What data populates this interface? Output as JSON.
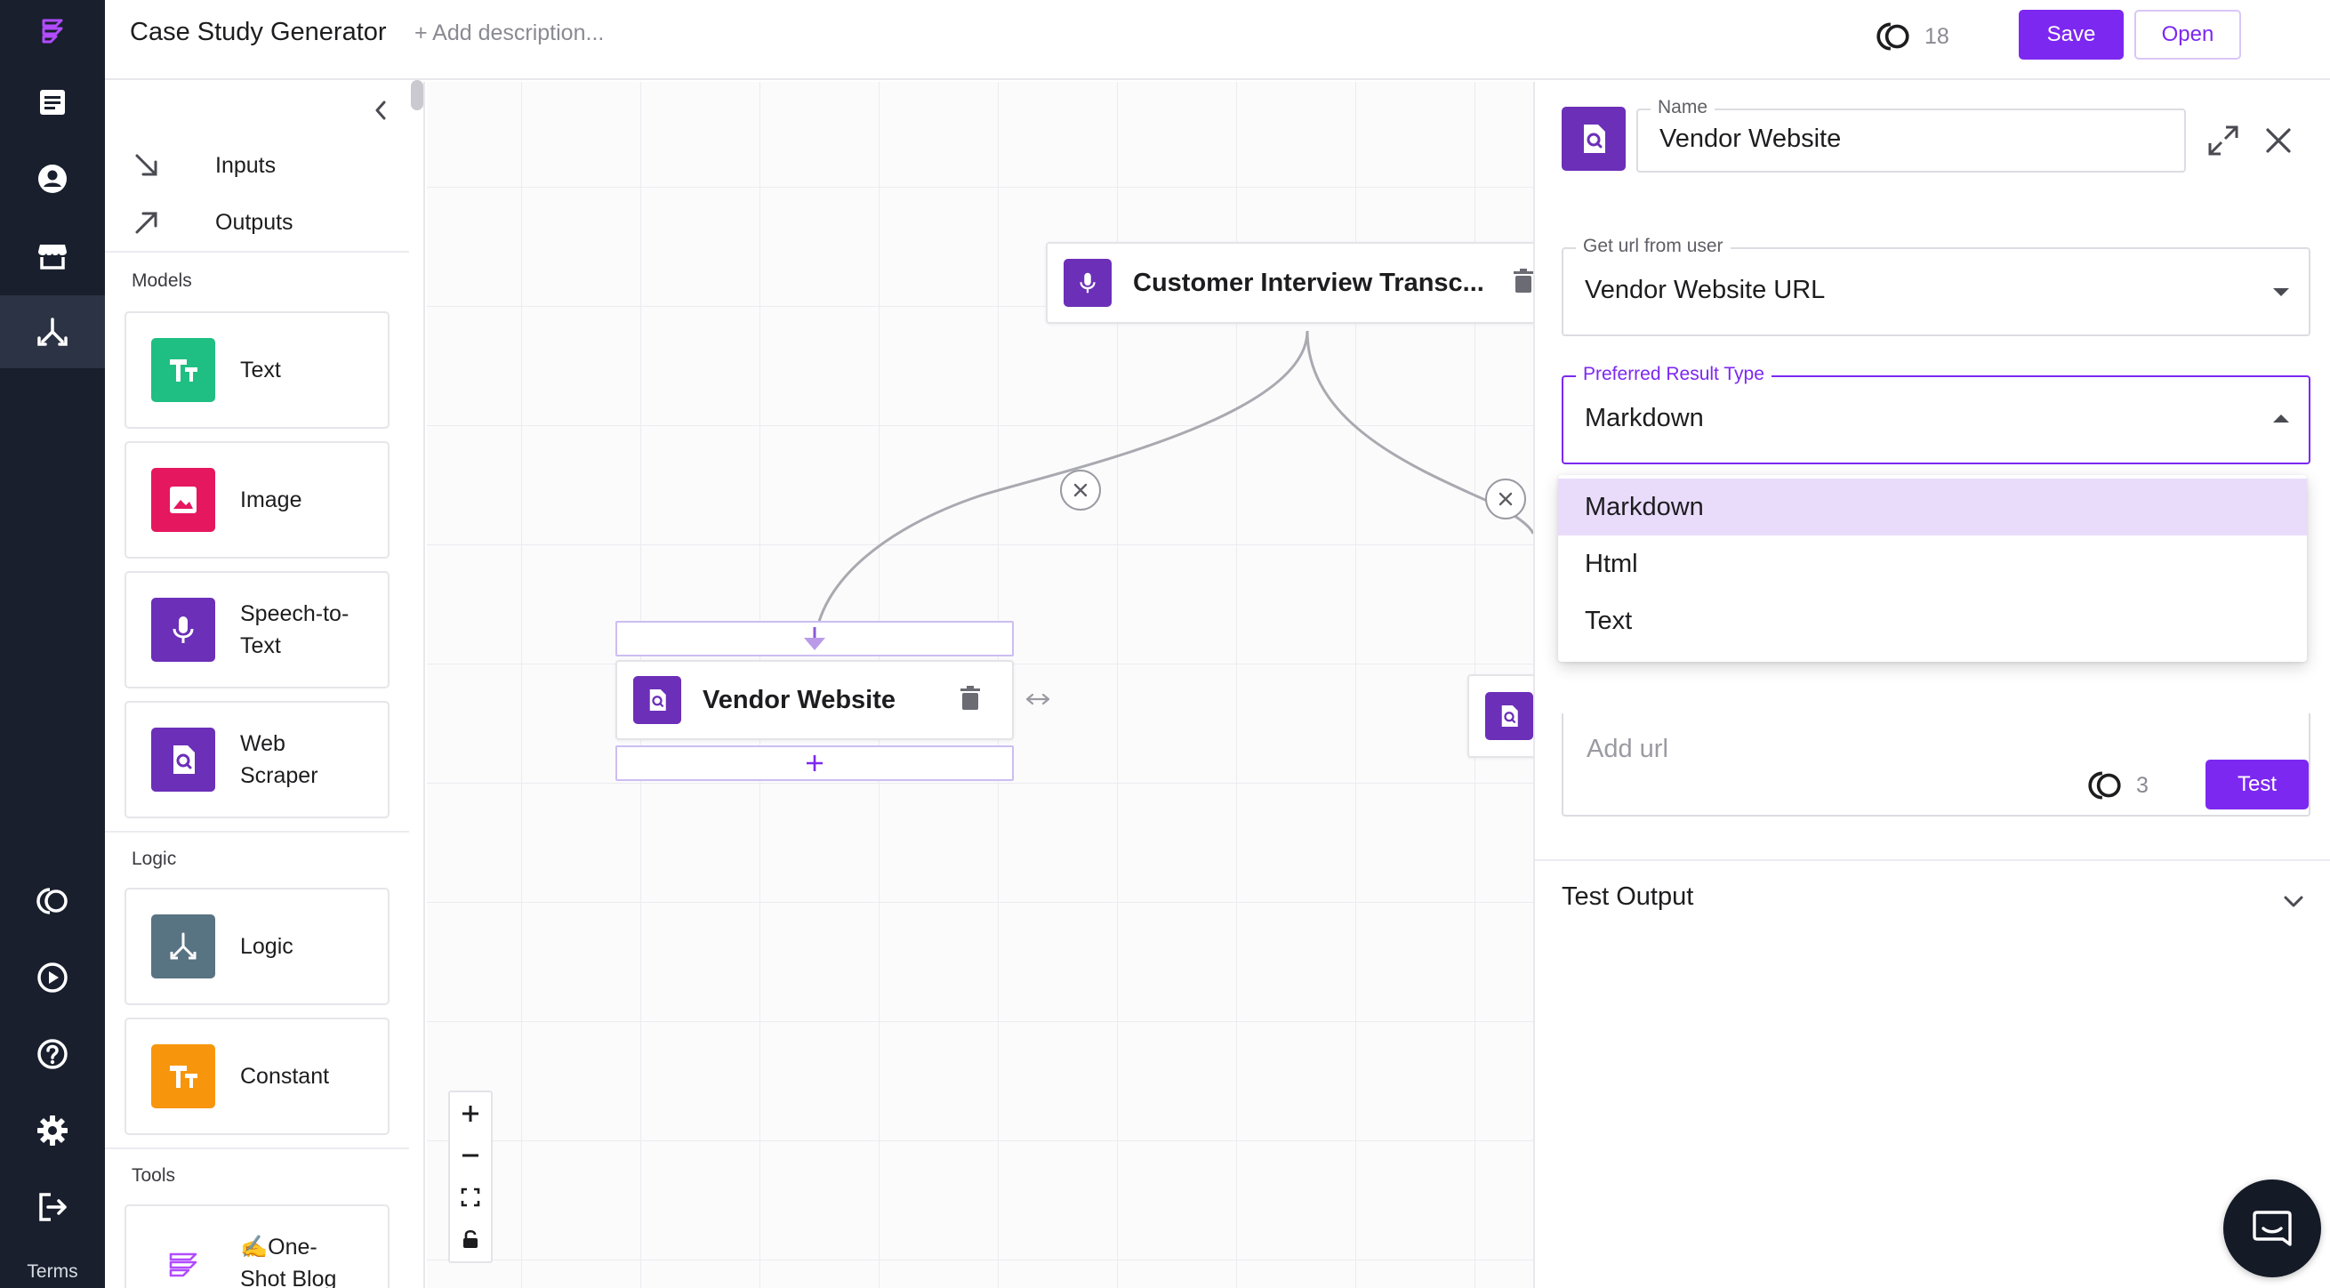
{
  "app": {
    "title": "Case Study Generator",
    "description_placeholder": "+ Add description...",
    "credits": "18",
    "save_label": "Save",
    "open_label": "Open",
    "accent_color": "#7c28f0"
  },
  "rail": {
    "items": [
      {
        "name": "logo-icon"
      },
      {
        "name": "documents-icon"
      },
      {
        "name": "account-icon"
      },
      {
        "name": "store-icon"
      },
      {
        "name": "workflow-icon",
        "active": true
      },
      {
        "name": "credits-icon"
      },
      {
        "name": "play-icon"
      },
      {
        "name": "help-icon"
      },
      {
        "name": "settings-icon"
      },
      {
        "name": "logout-icon"
      }
    ],
    "terms_label": "Terms"
  },
  "palette": {
    "inputs_label": "Inputs",
    "outputs_label": "Outputs",
    "sections": {
      "models": "Models",
      "logic": "Logic",
      "tools": "Tools"
    },
    "models": [
      {
        "label": "Text",
        "color": "#1fbf83",
        "icon": "text-icon"
      },
      {
        "label": "Image",
        "color": "#e5175f",
        "icon": "image-icon"
      },
      {
        "label": "Speech-to-\nText",
        "color": "#6b2fb8",
        "icon": "microphone-icon"
      },
      {
        "label": "Web\nScraper",
        "color": "#6b2fb8",
        "icon": "web-scraper-icon"
      }
    ],
    "logic": [
      {
        "label": "Logic",
        "color": "#587382",
        "icon": "logic-icon"
      },
      {
        "label": "Constant",
        "color": "#f7960d",
        "icon": "constant-icon"
      }
    ],
    "tools": [
      {
        "label": "✍️One-\nShot Blog",
        "icon": "tool-logo-icon"
      }
    ]
  },
  "canvas": {
    "nodes": [
      {
        "label": "Customer Interview Transc...",
        "icon": "microphone-icon"
      },
      {
        "label": "Vendor Website",
        "icon": "web-scraper-icon"
      }
    ]
  },
  "panel": {
    "name_label": "Name",
    "name_value": "Vendor Website",
    "url_source_label": "Get url from user",
    "url_source_value": "Vendor Website URL",
    "result_type_label": "Preferred Result Type",
    "result_type_value": "Markdown",
    "result_type_options": [
      "Markdown",
      "Html",
      "Text"
    ],
    "url_placeholder": "Add url",
    "test_credits": "3",
    "test_label": "Test",
    "test_output_label": "Test Output"
  }
}
